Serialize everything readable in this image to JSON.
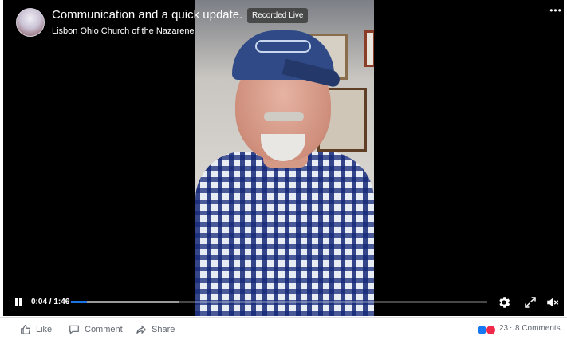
{
  "video": {
    "title": "Communication and a quick update.",
    "badge": "Recorded Live",
    "page_name": "Lisbon Ohio Church of the Nazarene",
    "more_label": "•••",
    "time_current": "0:04",
    "time_total": "1:46",
    "time_display": "0:04 / 1:46",
    "progress_fraction": 0.038,
    "buffered_fraction": 0.26,
    "is_playing": true
  },
  "actions": {
    "like_label": "Like",
    "comment_label": "Comment",
    "share_label": "Share"
  },
  "engagement": {
    "reaction_count": "23",
    "separator": "·",
    "comments_label": "8 Comments"
  },
  "colors": {
    "player_bg": "#000000",
    "accent": "#1b74e4",
    "like_blue": "#1877f2",
    "love_red": "#f0284a",
    "muted_text": "#606770"
  },
  "icons": {
    "play_toggle": "pause-icon",
    "settings": "gear-icon",
    "fullscreen": "expand-icon",
    "volume": "speaker-muted-icon",
    "more": "more-horizontal-icon",
    "like": "thumbs-up-icon",
    "comment": "speech-bubble-icon",
    "share": "share-arrow-icon"
  }
}
